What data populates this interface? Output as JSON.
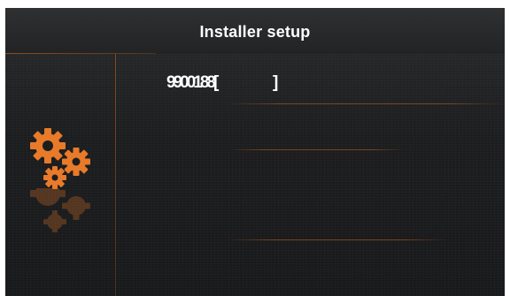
{
  "header": {
    "title": "Installer setup"
  },
  "field": {
    "value": "9900188[",
    "closing_bracket": "]"
  },
  "icons": {
    "settings": "gears-icon"
  },
  "colors": {
    "accent": "#E87A2A",
    "background": "#1C1D1F",
    "text": "#FFFFFF"
  }
}
